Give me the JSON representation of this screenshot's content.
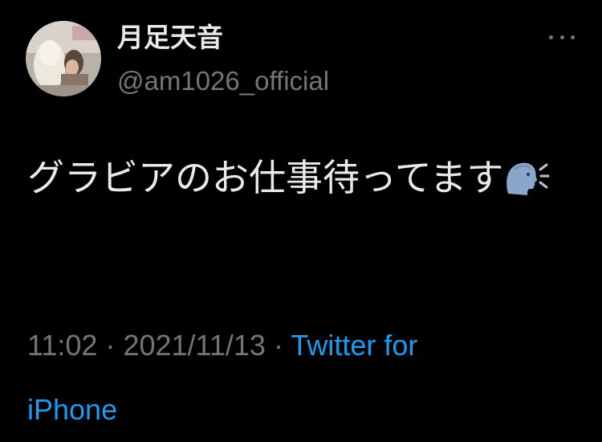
{
  "tweet": {
    "display_name": "月足天音",
    "handle": "@am1026_official",
    "text": "グラビアのお仕事待ってます",
    "emoji_icon": "speaking-head-icon",
    "time": "11:02",
    "separator": "·",
    "date": "2021/11/13",
    "source": "Twitter for iPhone"
  },
  "icons": {
    "more": "more-horizontal-icon"
  },
  "colors": {
    "background": "#000000",
    "primary_text": "#e7e9ea",
    "secondary_text": "#71767b",
    "link": "#1d9bf0"
  }
}
